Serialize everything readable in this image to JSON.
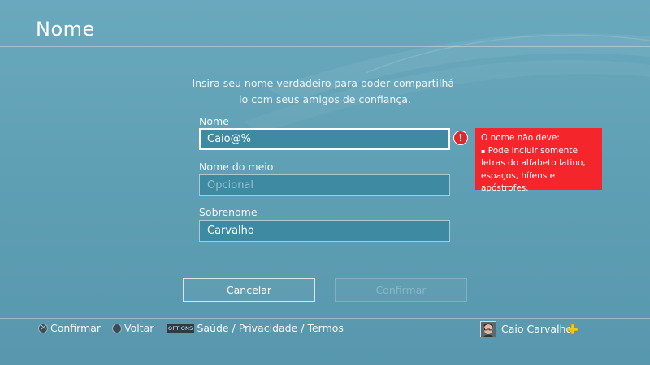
{
  "screen": {
    "title": "Nome"
  },
  "intro_text": "Insira seu nome verdadeiro para poder compartilhá-lo com seus amigos de confiança.",
  "form": {
    "first_name": {
      "label": "Nome",
      "value": "Caio@%"
    },
    "middle_name": {
      "label": "Nome do meio",
      "placeholder": "Opcional"
    },
    "last_name": {
      "label": "Sobrenome",
      "value": "Carvalho"
    }
  },
  "error": {
    "icon": "alert-icon",
    "heading": "O nome não deve:",
    "bullet": "Pode incluir somente letras do alfabeto latino, espaços, hífens e apóstrofes."
  },
  "buttons": {
    "cancel": "Cancelar",
    "confirm": "Confirmar"
  },
  "footer": {
    "hints": [
      {
        "icon": "cross-button-icon",
        "label": "Confirmar"
      },
      {
        "icon": "circle-button-icon",
        "label": "Voltar"
      },
      {
        "icon": "options-button-icon",
        "badge": "OPTIONS",
        "label": "Saúde / Privacidade / Termos"
      }
    ],
    "user": {
      "name": "Caio Carvalho",
      "badge_icon": "ps-plus-icon"
    }
  },
  "colors": {
    "background": "#5f9fb4",
    "field": "#3f8aa3",
    "error": "#f4262b",
    "plus": "#f5c518"
  }
}
